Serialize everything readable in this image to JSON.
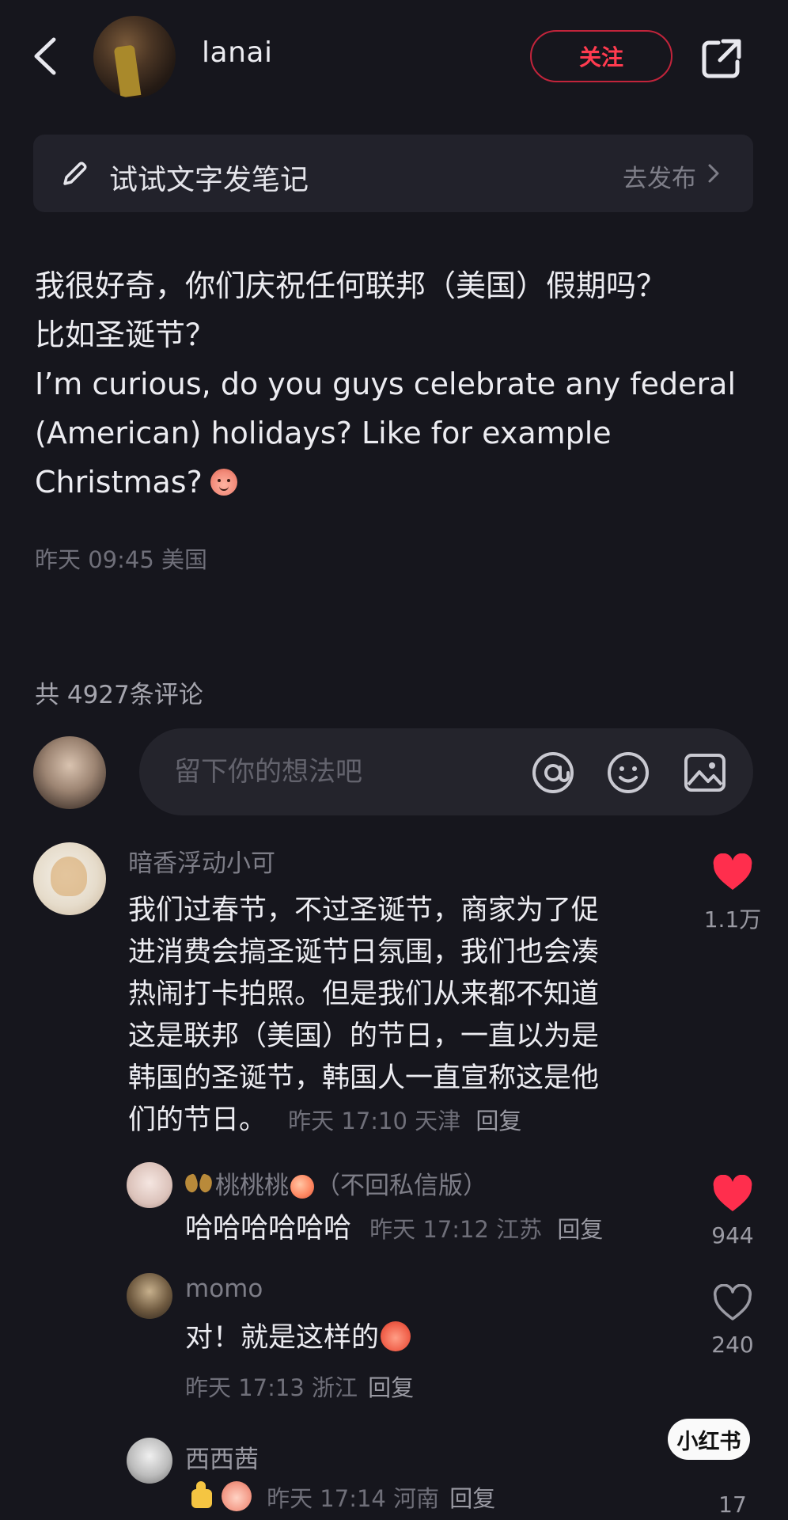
{
  "header": {
    "author_name": "lanai",
    "follow_label": "关注"
  },
  "note_bar": {
    "prompt": "试试文字发笔记",
    "action": "去发布"
  },
  "post": {
    "line_cn_1": "我很好奇，你们庆祝任何联邦（美国）假期吗？",
    "line_cn_2": "比如圣诞节？",
    "line_en_1": "I’m curious, do you guys celebrate any federal",
    "line_en_2": "(American) holidays? Like for example",
    "line_en_3": "Christmas?",
    "meta": "昨天 09:45 美国"
  },
  "comments_header": {
    "count_text": "共 4927条评论",
    "input_placeholder": "留下你的想法吧"
  },
  "comments": [
    {
      "name": "暗香浮动小可",
      "lines": [
        "我们过春节，不过圣诞节，商家为了促",
        "进消费会搞圣诞节日氛围，我们也会凑",
        "热闹打卡拍照。但是我们从来都不知道",
        "这是联邦（美国）的节日，一直以为是",
        "韩国的圣诞节，韩国人一直宣称这是他",
        "们的节日。"
      ],
      "meta": "昨天 17:10 天津",
      "reply": "回复",
      "likes": "1.1万",
      "liked": true
    },
    {
      "name": "桃桃桃",
      "name_suffix": "（不回私信版）",
      "text": "哈哈哈哈哈哈",
      "meta": "昨天 17:12 江苏",
      "reply": "回复",
      "likes": "944",
      "liked": true
    },
    {
      "name": "momo",
      "text": "对！就是这样的",
      "meta": "昨天 17:13 浙江",
      "reply": "回复",
      "likes": "240",
      "liked": false
    },
    {
      "name": "西西茜",
      "meta": "昨天 17:14 河南",
      "reply": "回复",
      "likes": "17",
      "liked": false
    }
  ],
  "watermark": "小红书",
  "colors": {
    "background": "#16161d",
    "accent_red": "#ff2e4d",
    "muted_text": "#6f6f79"
  }
}
